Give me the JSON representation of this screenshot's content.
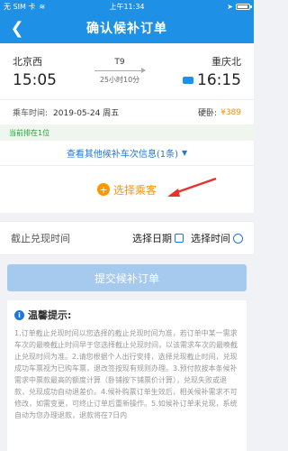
{
  "status_bar": {
    "carrier": "无 SIM 卡",
    "time": "上午11:34"
  },
  "nav": {
    "title": "确认候补订单"
  },
  "trip": {
    "from_station": "北京西",
    "from_time": "15:05",
    "train": "T9",
    "duration": "25小时10分",
    "to_station": "重庆北",
    "to_time": "16:15"
  },
  "seat": {
    "date_label": "乘车时间:",
    "date": "2019-05-24 周五",
    "seat_type": "硬卧:",
    "price": "¥389"
  },
  "queue": {
    "text": "当前排在1位"
  },
  "other_trains": {
    "label": "查看其他候补车次信息(1条)"
  },
  "select_passenger": {
    "label": "选择乘客"
  },
  "deadline": {
    "label": "截止兑现时间",
    "date_option": "选择日期",
    "time_option": "选择时间"
  },
  "submit": {
    "label": "提交候补订单"
  },
  "tips": {
    "title": "温馨提示:",
    "body": "1.订单截止兑现时间以您选择的截止兑现时间为准，若订单中某一需求车次的最晚截止时间早于您选择截止兑现时间，以该需求车次的最晚截止兑现时间为准。2.请您根据个人出行安排，选择兑现截止时间，兑现成功车票视为已购车票，退改签按现有规则办理。3.预付款按本条候补需求中票款最高的额度计算（卧铺按下铺票价计算），兑现失败或退款，兑现成功自动退差价。4.候补购票订单生效后，相关候补需求不可修改，如需变更，可终止订单后重新操作。5.如候补订单未兑现，系统自动为您办理退款，退款将在7日内"
  }
}
